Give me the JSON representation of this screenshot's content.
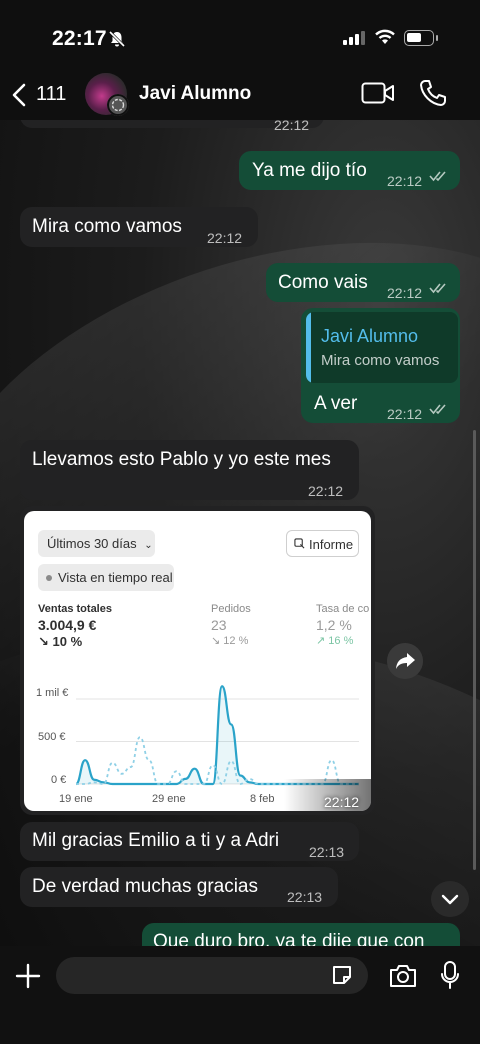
{
  "status_bar": {
    "time": "22:17"
  },
  "header": {
    "back_count": "111",
    "contact_name": "Javi Alumno"
  },
  "messages": [
    {
      "id": "m1",
      "dir": "out",
      "text": "Ya me dijo tío",
      "time": "22:12"
    },
    {
      "id": "m2",
      "dir": "in",
      "text": "Mira como vamos",
      "time": "22:12"
    },
    {
      "id": "m3",
      "dir": "out",
      "text": "Como vais",
      "time": "22:12"
    },
    {
      "id": "m4",
      "dir": "out",
      "text": "A ver",
      "time": "22:12",
      "quote": {
        "author": "Javi Alumno",
        "text": "Mira como vamos"
      }
    },
    {
      "id": "m5",
      "dir": "in",
      "text": "Llevamos esto Pablo y yo este mes",
      "time": "22:12"
    },
    {
      "id": "m7",
      "dir": "in",
      "text": "Mil gracias Emilio a ti y a Adri",
      "time": "22:13"
    },
    {
      "id": "m8",
      "dir": "in",
      "text": "De verdad muchas gracias",
      "time": "22:13"
    },
    {
      "id": "m9",
      "dir": "out",
      "text": "Que duro bro, ya te dije que con"
    }
  ],
  "top_partial_time": "22:12",
  "image_message": {
    "time": "22:12",
    "range_label": "Últimos 30 días",
    "report_label": "Informe",
    "live_label": "Vista en tiempo real",
    "metrics": [
      {
        "label": "Ventas totales",
        "value": "3.004,9 €",
        "change": "↘ 10 %"
      },
      {
        "label": "Pedidos",
        "value": "23",
        "change": "↘ 12 %"
      },
      {
        "label": "Tasa de co",
        "value": "1,2 %",
        "change": "↗ 16 %"
      }
    ]
  },
  "chart_data": {
    "type": "line",
    "ylabel_ticks": [
      "1 mil €",
      "500 €",
      "0 €"
    ],
    "x_ticks": [
      "19 ene",
      "29 ene",
      "8 feb"
    ],
    "ylim": [
      0,
      1200
    ],
    "series": [
      {
        "style": "solid",
        "values": [
          0,
          280,
          50,
          20,
          0,
          0,
          0,
          0,
          0,
          0,
          0,
          0,
          60,
          180,
          0,
          0,
          1150,
          700,
          100,
          20,
          0,
          0,
          0,
          0,
          0,
          0,
          0,
          0,
          0,
          0,
          0,
          0
        ]
      },
      {
        "style": "dashed",
        "values": [
          0,
          0,
          20,
          0,
          250,
          120,
          200,
          550,
          280,
          0,
          0,
          150,
          0,
          0,
          0,
          220,
          0,
          270,
          0,
          60,
          0,
          0,
          0,
          0,
          0,
          0,
          0,
          0,
          280,
          0,
          0,
          0
        ]
      }
    ]
  },
  "colors": {
    "incoming": "#222223",
    "outgoing": "#144d37",
    "accent": "#53bdeb",
    "chart_line": "#2aa3c9"
  }
}
